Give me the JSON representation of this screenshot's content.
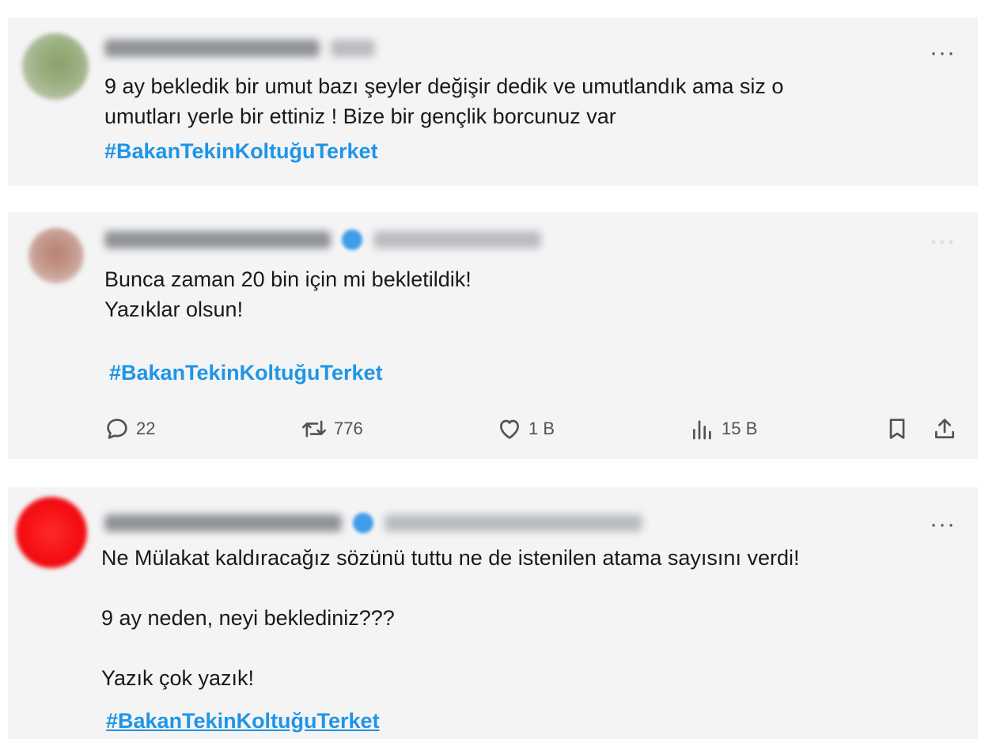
{
  "tweets": [
    {
      "more_label": "···",
      "text": "9 ay bekledik bir umut bazı şeyler değişir dedik ve umutlandık ama siz o\numutları yerle bir ettiniz ! Bize bir gençlik borcunuz var",
      "hashtag": "#BakanTekinKoltuğuTerket"
    },
    {
      "more_label": "···",
      "text": "Bunca zaman 20 bin için mi bekletildik!\nYazıklar olsun!",
      "hashtag": "#BakanTekinKoltuğuTerket",
      "actions": {
        "replies": "22",
        "retweets": "776",
        "likes": "1 B",
        "views": "15 B"
      },
      "icons": [
        "reply-icon",
        "retweet-icon",
        "like-icon",
        "views-icon",
        "bookmark-icon",
        "share-icon"
      ]
    },
    {
      "more_label": "···",
      "text": "Ne Mülakat kaldıracağız sözünü tuttu ne de istenilen atama sayısını verdi!\n\n9 ay neden, neyi beklediniz???\n\nYazık çok yazık!",
      "hashtag": "#BakanTekinKoltuğuTerket"
    }
  ],
  "colors": {
    "card_bg": "#f4f4f5",
    "text": "#17191c",
    "hashtag": "#1f95e6",
    "icon": "#4f5359",
    "verified": "#3f9de9"
  }
}
